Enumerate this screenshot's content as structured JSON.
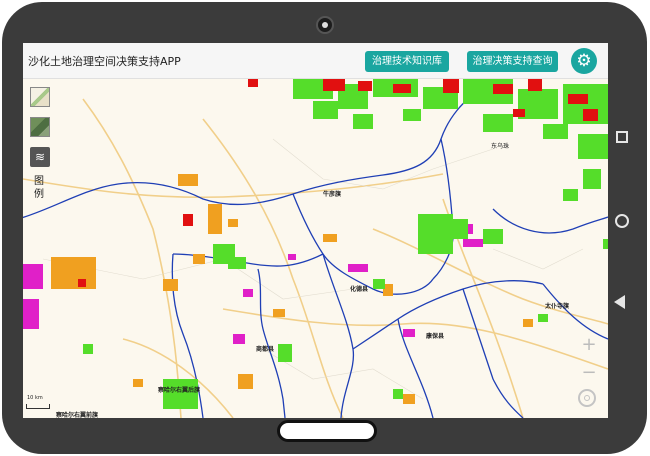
{
  "app": {
    "title": "沙化土地治理空间决策支持APP",
    "knowledge_btn": "治理技术知识库",
    "decision_btn": "治理决策支持查询",
    "settings_icon": "gear-icon"
  },
  "map_tools": {
    "legend_label": "图例",
    "layers_icon": "layers-icon",
    "zoom_in": "+",
    "zoom_out": "−",
    "scale": "10 km"
  },
  "map_labels": {
    "niuyi": "牛彦旗",
    "dongwuzhu": "东乌珠",
    "taipusi": "太仆寺旗",
    "kangbao": "康保县",
    "shangdu": "商都县",
    "huade": "化德县",
    "chahar": "察哈尔右翼后旗",
    "chahar_front": "察哈尔右翼前旗"
  },
  "colors": {
    "accent": "#1aa6a0",
    "border": "#1f3fb5",
    "class_severe": "#e11010",
    "class_green": "#55dd2a",
    "class_orange": "#f0a020",
    "class_magenta": "#e020c8"
  }
}
